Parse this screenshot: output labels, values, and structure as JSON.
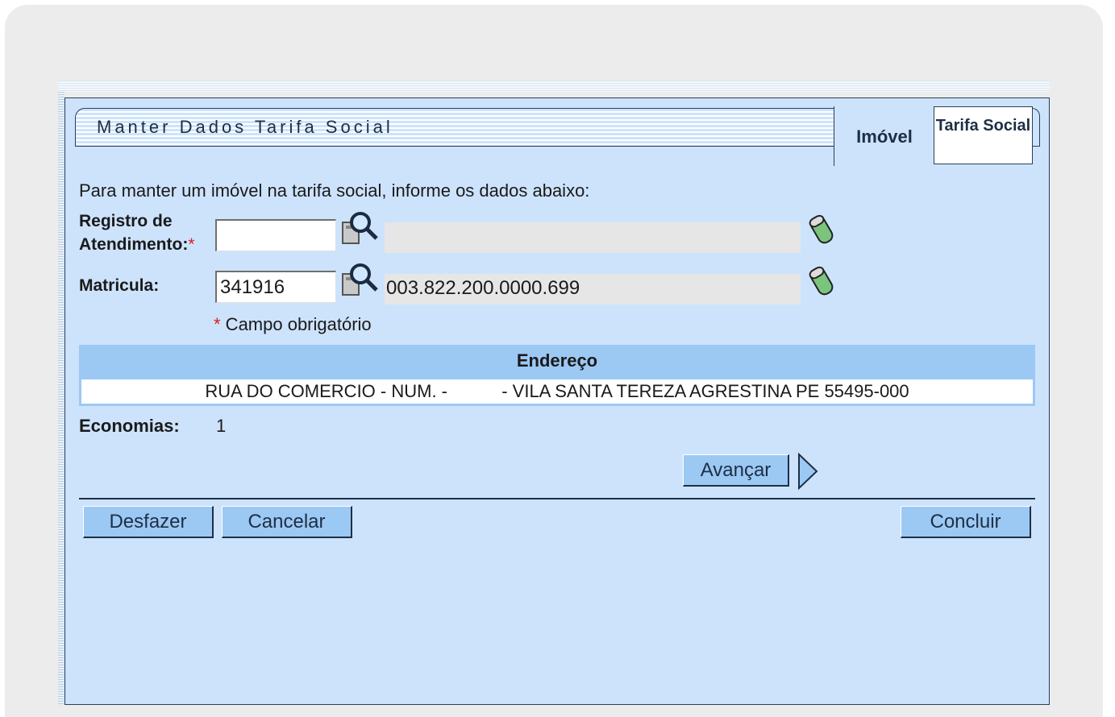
{
  "page": {
    "title": "Manter Dados Tarifa Social",
    "tabs": [
      {
        "label": "Imóvel",
        "active": true
      },
      {
        "label": "Tarifa Social",
        "active": false
      }
    ],
    "intro": "Para manter um imóvel na tarifa social, informe os dados abaixo:"
  },
  "form": {
    "registro_label": "Registro de Atendimento:",
    "registro_required_mark": "*",
    "registro_value": "",
    "registro_description": "",
    "matricula_label": "Matricula:",
    "matricula_value": "341916",
    "matricula_description": "003.822.200.0000.699",
    "required_note_mark": "*",
    "required_note": " Campo obrigatório"
  },
  "address": {
    "header": "Endereço",
    "value": "RUA DO COMERCIO - NUM. -           - VILA SANTA TEREZA AGRESTINA PE 55495-000"
  },
  "economias": {
    "label": "Economias:",
    "value": "1"
  },
  "buttons": {
    "avancar": "Avançar",
    "desfazer": "Desfazer",
    "cancelar": "Cancelar",
    "concluir": "Concluir"
  },
  "colors": {
    "panel_bg": "#cde3fc",
    "button_bg": "#9cc8f4",
    "required": "#d92020"
  },
  "icons": [
    "search-icon",
    "eraser-icon",
    "arrow-right-icon"
  ]
}
